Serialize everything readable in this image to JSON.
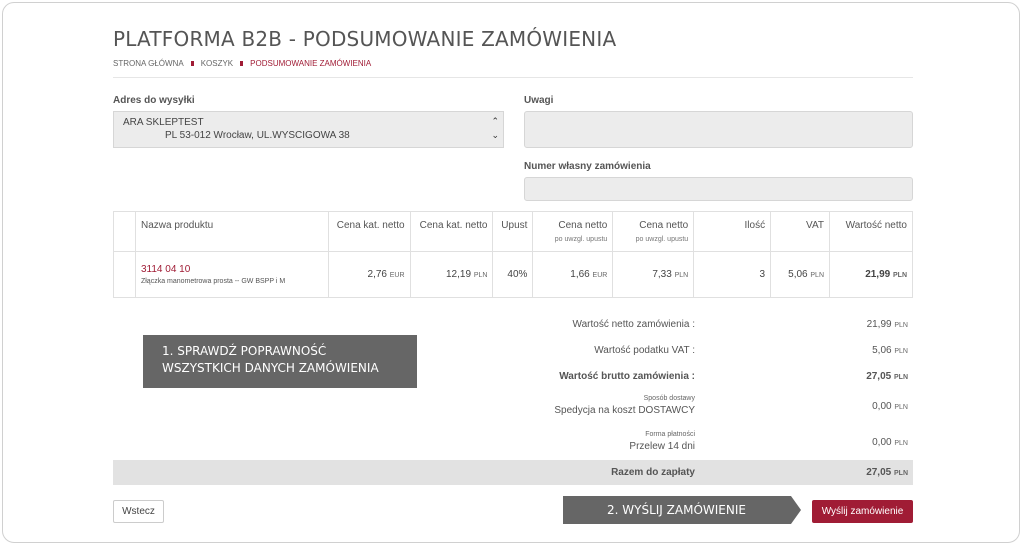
{
  "header": {
    "title": "PLATFORMA B2B - PODSUMOWANIE ZAMÓWIENIA",
    "breadcrumb": [
      "STRONA GŁÓWNA",
      "KOSZYK",
      "PODSUMOWANIE ZAMÓWIENIA"
    ]
  },
  "address": {
    "label": "Adres do wysyłki",
    "line1": "ARA SKLEPTEST",
    "line2": "PL  53-012 Wrocław, UL.WYSCIGOWA 38"
  },
  "notes": {
    "label": "Uwagi",
    "value": ""
  },
  "order_number": {
    "label": "Numer własny zamówienia",
    "value": ""
  },
  "table": {
    "headers": {
      "name": "Nazwa produktu",
      "cat_price_1": "Cena kat. netto",
      "cat_price_2": "Cena kat. netto",
      "discount": "Upust",
      "net_price_1": "Cena netto",
      "net_price_1_sub": "po uwzgl. upustu",
      "net_price_2": "Cena netto",
      "net_price_2_sub": "po uwzgl. upustu",
      "qty": "Ilość",
      "vat": "VAT",
      "net_value": "Wartość netto"
    },
    "row": {
      "code": "3114 04 10",
      "name": "Złączka manometrowa prosta -- GW BSPP i M",
      "cat_price_eur": "2,76",
      "cat_price_pln": "12,19",
      "discount": "40%",
      "net_price_eur": "1,66",
      "net_price_pln": "7,33",
      "qty": "3",
      "vat": "5,06",
      "net_value": "21,99",
      "cur_eur": "EUR",
      "cur_pln": "PLN"
    }
  },
  "summary": {
    "net_label": "Wartość netto zamówienia :",
    "net_value": "21,99",
    "vat_label": "Wartość podatku VAT :",
    "vat_value": "5,06",
    "gross_label": "Wartość brutto zamówienia :",
    "gross_value": "27,05",
    "delivery_small": "Sposób dostawy",
    "delivery_label": "Spedycja na koszt DOSTAWCY",
    "delivery_value": "0,00",
    "payment_small": "Forma płatności",
    "payment_label": "Przelew 14 dni",
    "payment_value": "0,00",
    "total_label": "Razem do zapłaty",
    "total_value": "27,05",
    "currency": "PLN"
  },
  "callouts": {
    "step1_line1": "1. SPRAWDŹ POPRAWNOŚĆ",
    "step1_line2": "WSZYSTKICH DANYCH ZAMÓWIENIA",
    "step2": "2. WYŚLIJ ZAMÓWIENIE"
  },
  "buttons": {
    "back": "Wstecz",
    "send": "Wyślij zamówienie"
  },
  "colors": {
    "accent": "#a01c35",
    "callout": "#666666"
  }
}
